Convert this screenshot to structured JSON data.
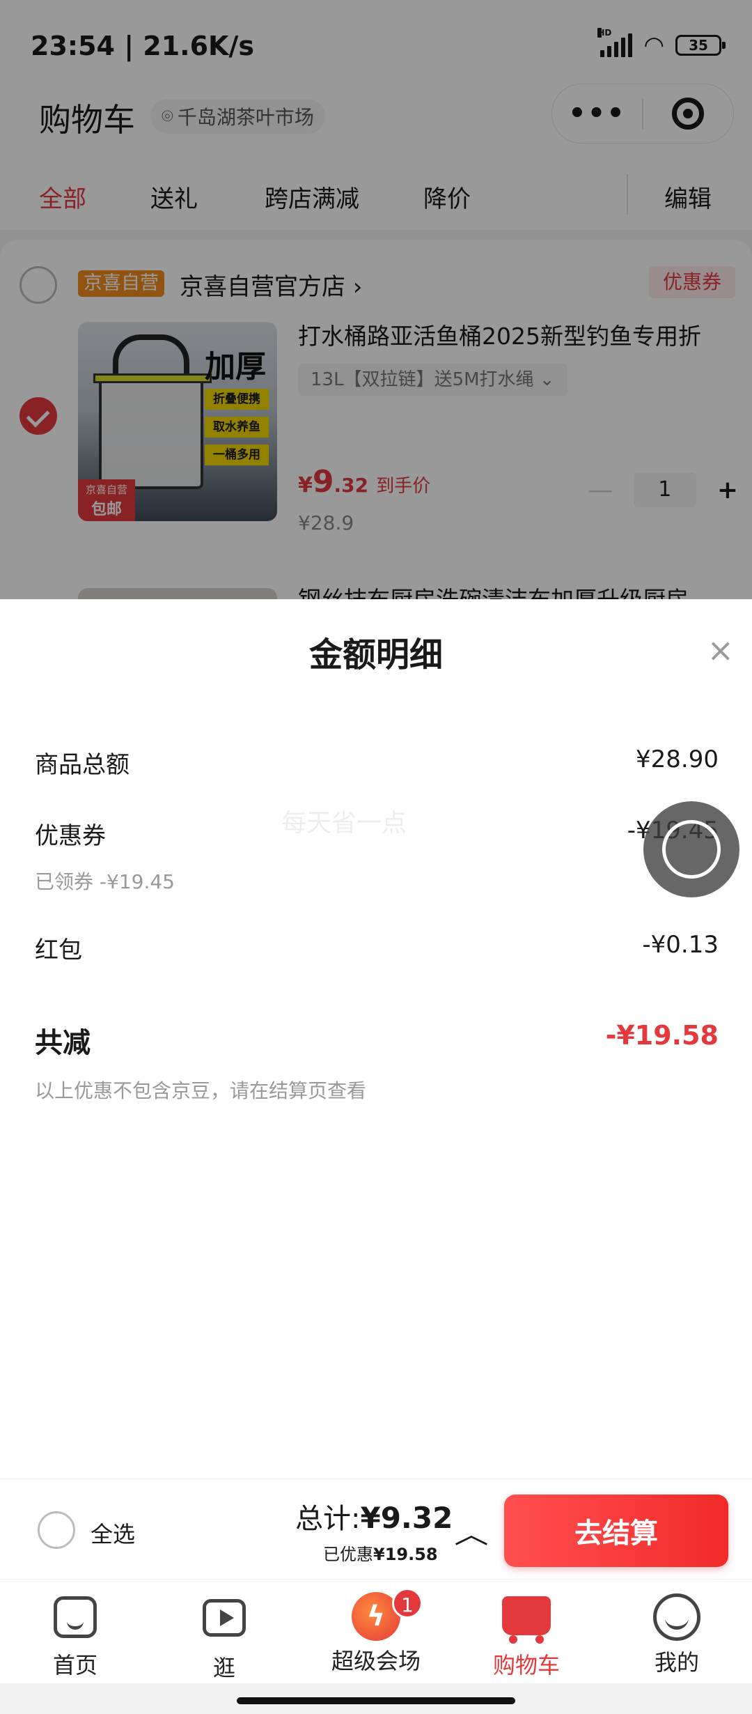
{
  "status_bar": {
    "time": "23:54 | 21.6K/s",
    "network": "HD",
    "battery": "35"
  },
  "header": {
    "title": "购物车",
    "location": "千岛湖茶叶市场"
  },
  "tabs": [
    "全部",
    "送礼",
    "跨店满减",
    "降价"
  ],
  "edit_label": "编辑",
  "shop": {
    "tag": "京喜自营",
    "name": "京喜自营官方店 ›",
    "coupon": "优惠券"
  },
  "product": {
    "title": "打水桶路亚活鱼桶2025新型钓鱼专用折",
    "spec": "13L【双拉链】送5M打水绳  ⌄",
    "price_symbol": "¥",
    "price_int": "9",
    "price_dec": ".32",
    "price_label": "到手价",
    "original_price": "¥28.9",
    "quantity": "1",
    "image_text": {
      "headline": "加厚",
      "tags": [
        "折叠便携",
        "取水养鱼",
        "一桶多用"
      ],
      "badge_top": "京喜自营",
      "badge_bottom": "包邮"
    }
  },
  "next_product": {
    "title": "钢丝抹布厨房洗碗清洁布加厚升级厨房"
  },
  "sheet": {
    "title": "金额明细",
    "close": "×",
    "watermark": "每天省一点",
    "rows": [
      {
        "label": "商品总额",
        "value": "¥28.90"
      },
      {
        "label": "优惠券",
        "value": "-¥19.45",
        "sub": "已领券 -¥19.45"
      },
      {
        "label": "红包",
        "value": "-¥0.13"
      }
    ],
    "total_label": "共减",
    "total_value": "-¥19.58",
    "note": "以上优惠不包含京豆，请在结算页查看"
  },
  "checkout": {
    "select_all": "全选",
    "total_prefix": "总计:",
    "total_amount": "¥9.32",
    "saved_prefix": "已优惠",
    "saved_amount": "¥19.58",
    "button": "去结算"
  },
  "nav": [
    {
      "label": "首页",
      "icon": "home-icon"
    },
    {
      "label": "逛",
      "icon": "play-icon"
    },
    {
      "label": "超级会场",
      "icon": "bolt-icon",
      "badge": "1"
    },
    {
      "label": "购物车",
      "icon": "cart-icon",
      "active": true
    },
    {
      "label": "我的",
      "icon": "smile-icon"
    }
  ],
  "colors": {
    "accent": "#e4393c",
    "tag_orange": "#f08a1c"
  }
}
